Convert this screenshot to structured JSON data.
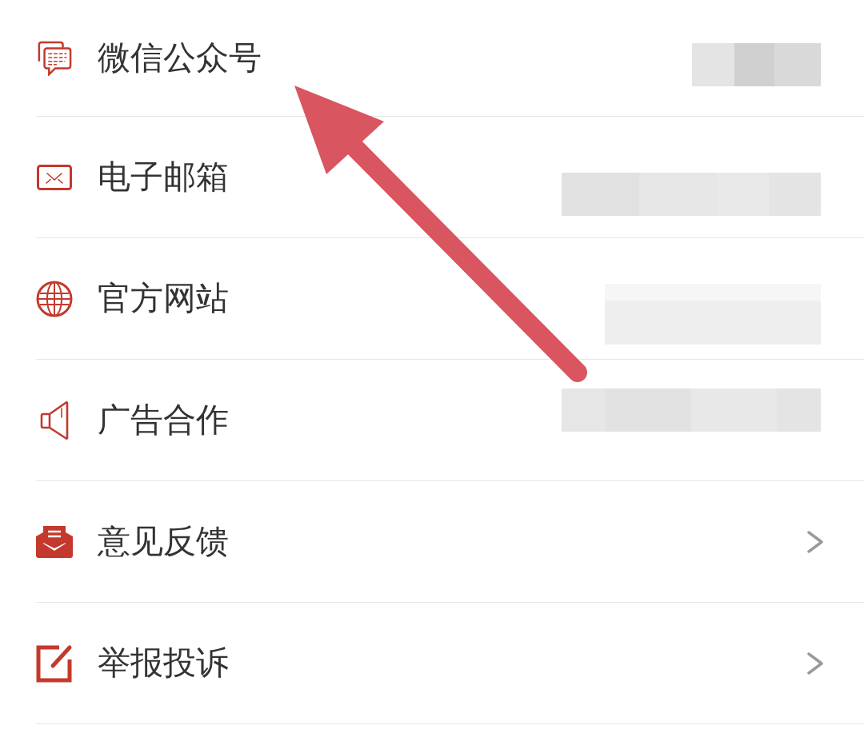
{
  "menu": {
    "items": [
      {
        "label": "微信公众号",
        "kind": "value"
      },
      {
        "label": "电子邮箱",
        "kind": "value"
      },
      {
        "label": "官方网站",
        "kind": "value"
      },
      {
        "label": "广告合作",
        "kind": "value"
      },
      {
        "label": "意见反馈",
        "kind": "link"
      },
      {
        "label": "举报投诉",
        "kind": "link"
      }
    ]
  },
  "annotation": {
    "kind": "arrow"
  }
}
